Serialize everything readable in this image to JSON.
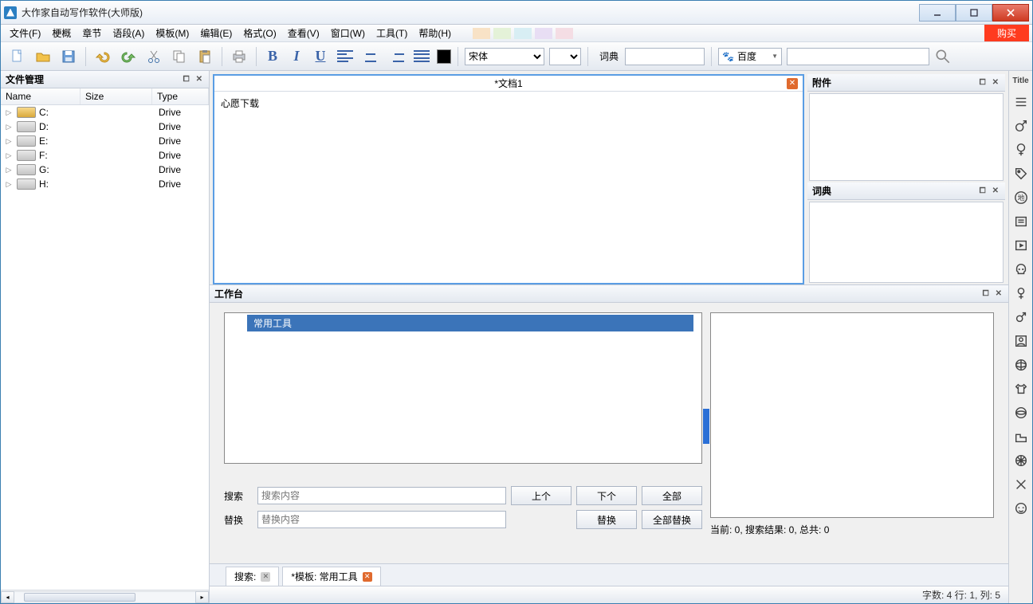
{
  "title": "大作家自动写作软件(大师版)",
  "buy": "购买",
  "menu": [
    "文件(F)",
    "梗概",
    "章节",
    "语段(A)",
    "模板(M)",
    "编辑(E)",
    "格式(O)",
    "查看(V)",
    "窗口(W)",
    "工具(T)",
    "帮助(H)"
  ],
  "swatches": [
    "#f8e2c6",
    "#e4f2d8",
    "#d8eef4",
    "#e8def4",
    "#f4dde4"
  ],
  "toolbar": {
    "font": "宋体",
    "dict_label": "词典",
    "search_engine": "百度"
  },
  "file_panel": {
    "title": "文件管理",
    "cols": {
      "name": "Name",
      "size": "Size",
      "type": "Type"
    },
    "rows": [
      {
        "name": "C:",
        "type": "Drive",
        "iconClass": "c"
      },
      {
        "name": "D:",
        "type": "Drive",
        "iconClass": ""
      },
      {
        "name": "E:",
        "type": "Drive",
        "iconClass": ""
      },
      {
        "name": "F:",
        "type": "Drive",
        "iconClass": ""
      },
      {
        "name": "G:",
        "type": "Drive",
        "iconClass": ""
      },
      {
        "name": "H:",
        "type": "Drive",
        "iconClass": ""
      }
    ]
  },
  "doc": {
    "tab": "*文档1",
    "body": "心愿下载"
  },
  "att": {
    "title": "附件"
  },
  "dict": {
    "title": "词典"
  },
  "workbench": {
    "title": "工作台",
    "item": "常用工具",
    "search_lbl": "搜索",
    "search_ph": "搜索内容",
    "replace_lbl": "替换",
    "replace_ph": "替换内容",
    "btn_prev": "上个",
    "btn_next": "下个",
    "btn_all": "全部",
    "btn_replace": "替换",
    "btn_replace_all": "全部替换",
    "status": "当前: 0, 搜索结果: 0, 总共: 0"
  },
  "bottom_tabs": {
    "search": "搜索:",
    "template": "*模板: 常用工具"
  },
  "status": "字数: 4 行: 1, 列: 5",
  "right_title": "Title"
}
